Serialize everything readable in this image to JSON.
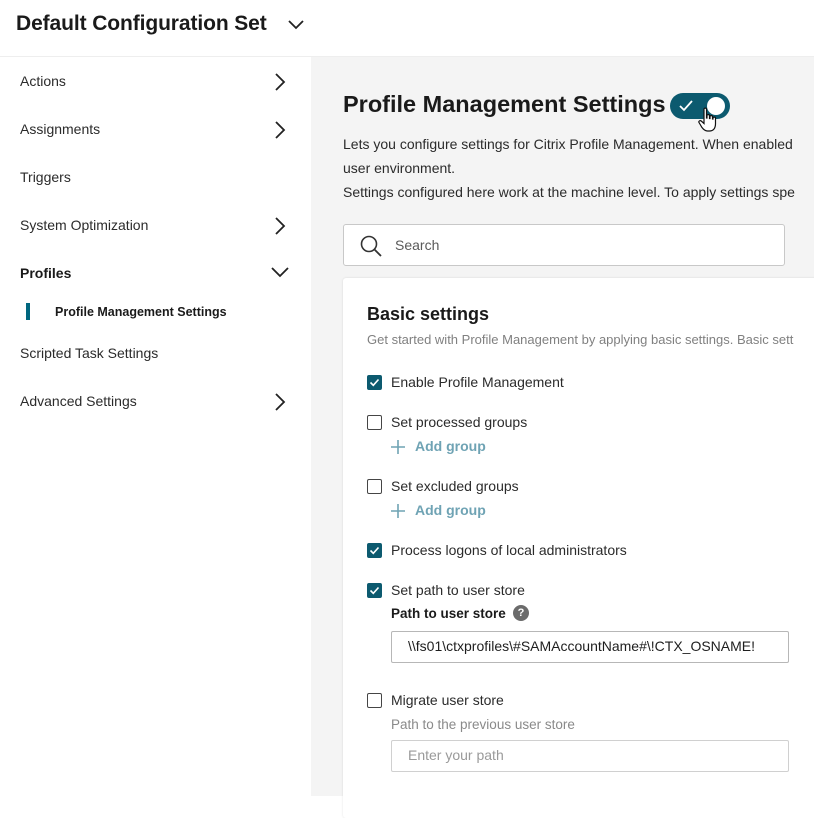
{
  "header": {
    "title": "Default Configuration Set"
  },
  "sidebar": {
    "items": [
      {
        "label": "Actions"
      },
      {
        "label": "Assignments"
      },
      {
        "label": "Triggers"
      },
      {
        "label": "System Optimization"
      },
      {
        "label": "Profiles"
      },
      {
        "label": "Profile Management Settings"
      },
      {
        "label": "Scripted Task Settings"
      },
      {
        "label": "Advanced Settings"
      }
    ]
  },
  "main": {
    "title": "Profile Management Settings",
    "toggle_on": true,
    "description_lines": [
      "Lets you configure settings for Citrix Profile Management. When enabled",
      "user environment.",
      "Settings configured here work at the machine level. To apply settings spe"
    ],
    "search": {
      "placeholder": "Search"
    },
    "card": {
      "title": "Basic settings",
      "subtitle": "Get started with Profile Management by applying basic settings. Basic sett",
      "options": [
        {
          "label": "Enable Profile Management",
          "checked": true
        },
        {
          "label": "Set processed groups",
          "checked": false,
          "add_label": "Add group"
        },
        {
          "label": "Set excluded groups",
          "checked": false,
          "add_label": "Add group"
        },
        {
          "label": "Process logons of local administrators",
          "checked": true
        },
        {
          "label": "Set path to user store",
          "checked": true
        },
        {
          "label": "Migrate user store",
          "checked": false
        }
      ],
      "path_field": {
        "label": "Path to user store",
        "help": "?",
        "value": "\\\\fs01\\ctxprofiles\\#SAMAccountName#\\!CTX_OSNAME!"
      },
      "migrate_field": {
        "label": "Path to the previous user store",
        "placeholder": "Enter your path"
      }
    }
  },
  "colors": {
    "accent": "#0c5a6f",
    "link": "#6fa3b4",
    "background": "#f4f4f4"
  },
  "icons": [
    "chevron-down-icon",
    "chevron-right-icon",
    "search-icon",
    "checkmark-icon",
    "plus-icon",
    "help-icon",
    "hand-cursor-icon"
  ]
}
